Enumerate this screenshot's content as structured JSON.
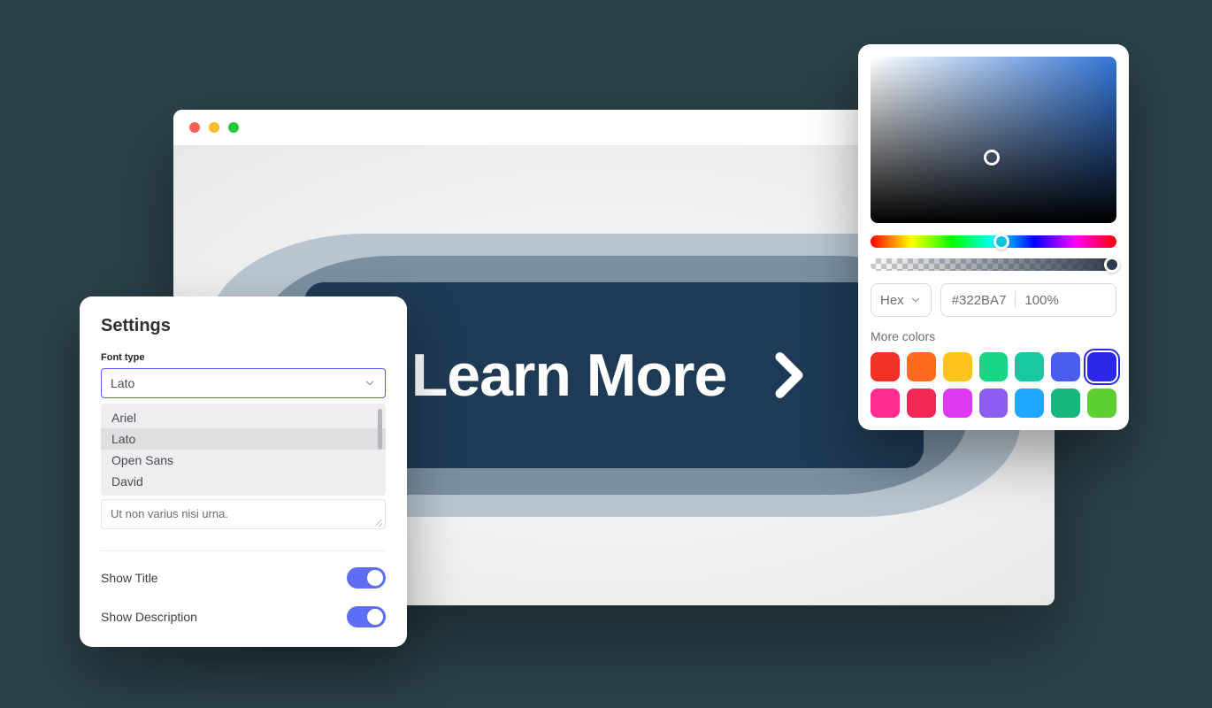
{
  "browser": {
    "button_label": "Learn More"
  },
  "settings": {
    "title": "Settings",
    "font_type_label": "Font type",
    "selected_font": "Lato",
    "font_options": [
      "Ariel",
      "Lato",
      "Open Sans",
      "David"
    ],
    "selected_index": 1,
    "textarea_value": "Ut non varius nisi urna.",
    "show_title_label": "Show Title",
    "show_title": true,
    "show_description_label": "Show Description",
    "show_description": true
  },
  "picker": {
    "format_label": "Hex",
    "hex_value": "#322BA7",
    "alpha_value": "100%",
    "more_colors_label": "More colors",
    "swatches": [
      "#f33127",
      "#ff6a1f",
      "#ffc31f",
      "#17d584",
      "#17c8a0",
      "#4a5df0",
      "#2b29e6",
      "#ff2d8f",
      "#f32756",
      "#de3bf0",
      "#8b5df0",
      "#1fa8ff",
      "#17b77e",
      "#5fd033"
    ],
    "selected_swatch": 6
  }
}
